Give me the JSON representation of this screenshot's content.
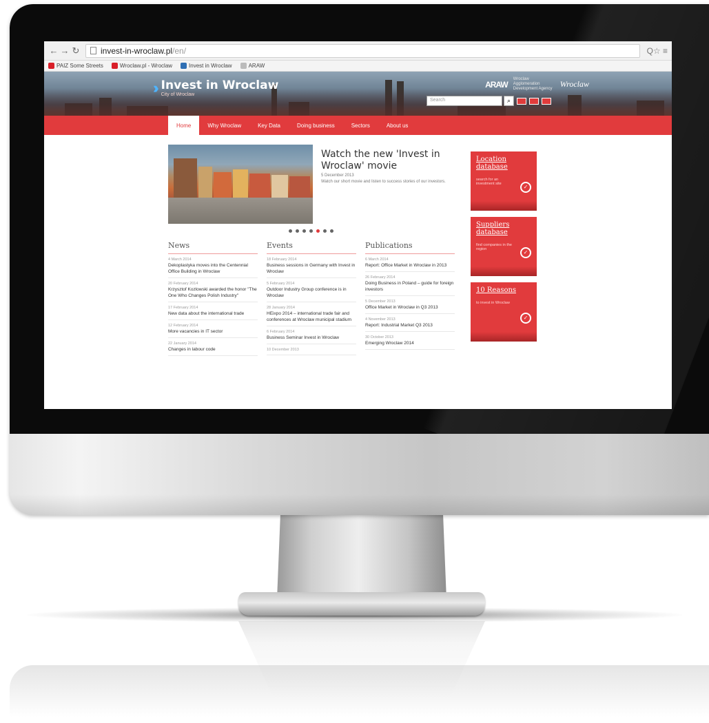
{
  "browser": {
    "url_host": "invest-in-wroclaw.pl",
    "url_path": "/en/",
    "icons": {
      "back": "back-arrow-icon",
      "forward": "forward-arrow-icon",
      "reload": "reload-icon"
    },
    "right_icons": "Q☆ ≡",
    "bookmarks": [
      {
        "label": "PAIZ Some Streets",
        "icon": "heart-bookmark-icon",
        "color": "#d9202a"
      },
      {
        "label": "Wroclaw.pl - Wroclaw",
        "icon": "page-bookmark-icon",
        "color": "#d9202a"
      },
      {
        "label": "Invest in Wroclaw",
        "icon": "page-bookmark-icon",
        "color": "#2f6fb4"
      },
      {
        "label": "ARAW",
        "icon": "page-bookmark-icon",
        "color": "#bbbbbb"
      }
    ]
  },
  "site": {
    "logo_text": "Invest in Wroclaw",
    "logo_sub": "City of Wroclaw",
    "slogan": "Wroclaw",
    "agency_logo": "ARAW",
    "agency_text": "Wroclaw Agglomeration Development Agency",
    "search_placeholder": "Search",
    "accent": "#e13b3d"
  },
  "nav": [
    "Home",
    "Why Wroclaw",
    "Key Data",
    "Doing business",
    "Sectors",
    "About us"
  ],
  "slider": {
    "title": "Watch the new 'Invest in Wroclaw' movie",
    "date": "5 December 2013",
    "desc": "Watch our short movie and listen to success stories of our investors.",
    "dot_count": 7,
    "active_dot": 4
  },
  "columns": [
    {
      "title": "News",
      "items": [
        {
          "date": "4 March 2014",
          "text": "Dekoplastyka moves into the Centennial Office Building in Wroclaw"
        },
        {
          "date": "20 February 2014",
          "text": "Krzysztof Kozlowski awarded the honor \"The One Who Changes Polish Industry\""
        },
        {
          "date": "17 February 2014",
          "text": "New data about the international trade"
        },
        {
          "date": "12 February 2014",
          "text": "More vacancies in IT sector"
        },
        {
          "date": "22 January 2014",
          "text": "Changes in labour code"
        }
      ]
    },
    {
      "title": "Events",
      "items": [
        {
          "date": "18 February 2014",
          "text": "Business sessions in Germany with Invest in Wroclaw"
        },
        {
          "date": "5 February 2014",
          "text": "Outdoor Industry Group conference is in Wroclaw"
        },
        {
          "date": "28 January 2014",
          "text": "HEixpo 2014 – international trade fair and conferences at Wroclaw municipal stadium"
        },
        {
          "date": "6 February 2014",
          "text": "Business Seminar Invest in Wroclaw"
        },
        {
          "date": "10 December 2013",
          "text": ""
        }
      ]
    },
    {
      "title": "Publications",
      "items": [
        {
          "date": "6 March 2014",
          "text": "Report: Office Market in Wroclaw in 2013"
        },
        {
          "date": "26 February 2014",
          "text": "Doing Business in Poland – guide for foreign investors"
        },
        {
          "date": "5 December 2013",
          "text": "Office Market in Wroclaw in Q3 2013"
        },
        {
          "date": "4 November 2013",
          "text": "Report: Industrial Market Q3 2013"
        },
        {
          "date": "30 October 2013",
          "text": "Emerging Wroclaw 2014"
        }
      ]
    }
  ],
  "sidebar": [
    {
      "title": "Location database",
      "sub": "search for an investment site",
      "icon": "location-check-icon"
    },
    {
      "title": "Suppliers database",
      "sub": "find companies in the region",
      "icon": "location-check-icon"
    },
    {
      "title": "10 Reasons",
      "sub": "to invest in Wroclaw",
      "icon": "location-check-icon"
    }
  ]
}
